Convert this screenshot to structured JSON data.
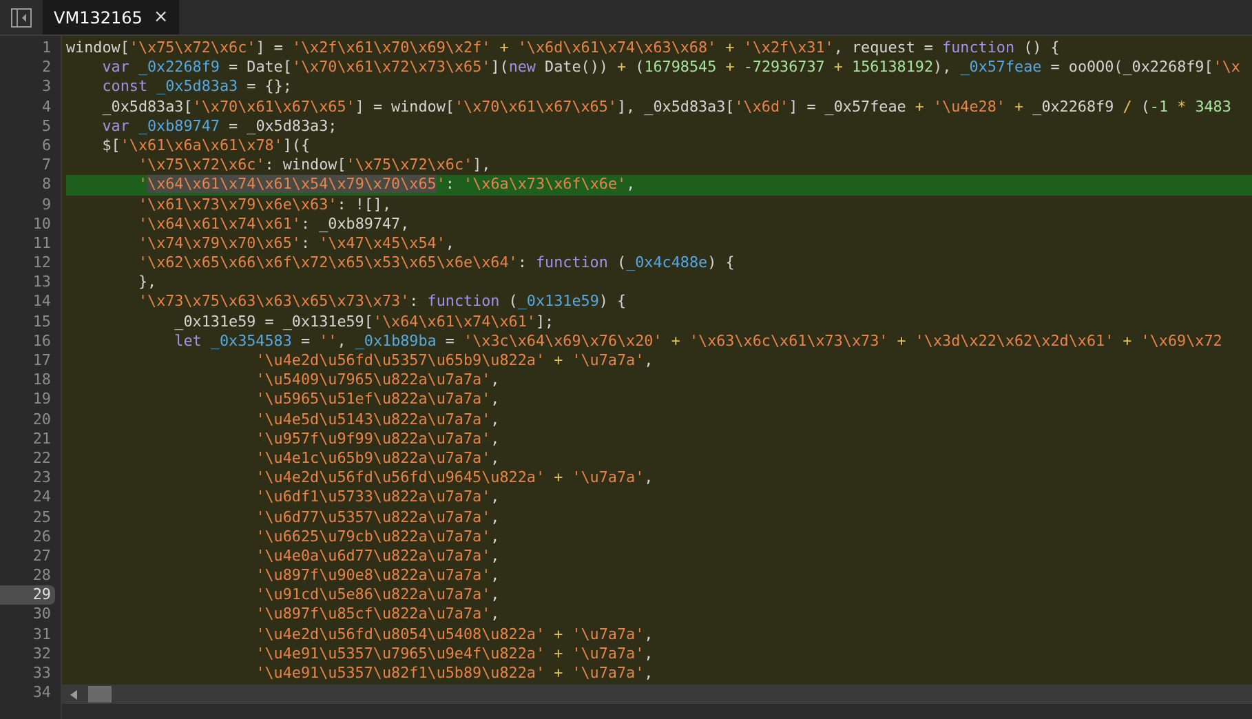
{
  "tab": {
    "title": "VM132165",
    "close": "×",
    "selected": true
  },
  "lines": [
    {
      "n": "1",
      "kind": "top",
      "highlighted": false,
      "marked": false,
      "tokens": [
        {
          "kind": "plain",
          "text": "window["
        },
        {
          "kind": "string",
          "text": "'\\x75\\x72\\x6c'"
        },
        {
          "kind": "plain",
          "text": "] = "
        },
        {
          "kind": "string",
          "text": "'\\x2f\\x61\\x70\\x69\\x2f'"
        },
        {
          "kind": "op",
          "text": " + "
        },
        {
          "kind": "string",
          "text": "'\\x6d\\x61\\x74\\x63\\x68'"
        },
        {
          "kind": "op",
          "text": " + "
        },
        {
          "kind": "string",
          "text": "'\\x2f\\x31'"
        },
        {
          "kind": "plain",
          "text": ", request = "
        },
        {
          "kind": "keyword",
          "text": "function"
        },
        {
          "kind": "plain",
          "text": " () {"
        }
      ]
    },
    {
      "n": "2",
      "kind": "body",
      "highlighted": false,
      "marked": false,
      "tokens": [
        {
          "kind": "keyword",
          "text": "var"
        },
        {
          "kind": "name",
          "text": " _0x2268f9"
        },
        {
          "kind": "plain",
          "text": " = Date["
        },
        {
          "kind": "string",
          "text": "'\\x70\\x61\\x72\\x73\\x65'"
        },
        {
          "kind": "plain",
          "text": "]("
        },
        {
          "kind": "keyword",
          "text": "new"
        },
        {
          "kind": "plain",
          "text": " Date())"
        },
        {
          "kind": "op",
          "text": " + "
        },
        {
          "kind": "plain",
          "text": "("
        },
        {
          "kind": "number",
          "text": "16798545"
        },
        {
          "kind": "op",
          "text": " + "
        },
        {
          "kind": "number",
          "text": "-72936737"
        },
        {
          "kind": "op",
          "text": " + "
        },
        {
          "kind": "number",
          "text": "156138192"
        },
        {
          "kind": "plain",
          "text": "), "
        },
        {
          "kind": "name",
          "text": "_0x57feae"
        },
        {
          "kind": "plain",
          "text": " = oo0O0(_0x2268f9["
        },
        {
          "kind": "string",
          "text": "'\\x"
        }
      ]
    },
    {
      "n": "3",
      "kind": "body",
      "highlighted": false,
      "marked": false,
      "tokens": [
        {
          "kind": "keyword",
          "text": "const"
        },
        {
          "kind": "name",
          "text": " _0x5d83a3"
        },
        {
          "kind": "plain",
          "text": " = {};"
        }
      ]
    },
    {
      "n": "4",
      "kind": "body",
      "highlighted": false,
      "marked": false,
      "tokens": [
        {
          "kind": "plain",
          "text": "_0x5d83a3["
        },
        {
          "kind": "string",
          "text": "'\\x70\\x61\\x67\\x65'"
        },
        {
          "kind": "plain",
          "text": "] = window["
        },
        {
          "kind": "string",
          "text": "'\\x70\\x61\\x67\\x65'"
        },
        {
          "kind": "plain",
          "text": "], _0x5d83a3["
        },
        {
          "kind": "string",
          "text": "'\\x6d'"
        },
        {
          "kind": "plain",
          "text": "] = _0x57feae"
        },
        {
          "kind": "op",
          "text": " + "
        },
        {
          "kind": "string",
          "text": "'\\u4e28'"
        },
        {
          "kind": "op",
          "text": " + "
        },
        {
          "kind": "plain",
          "text": "_0x2268f9"
        },
        {
          "kind": "op",
          "text": " / "
        },
        {
          "kind": "plain",
          "text": "("
        },
        {
          "kind": "number",
          "text": "-1"
        },
        {
          "kind": "op",
          "text": " * "
        },
        {
          "kind": "number",
          "text": "3483"
        }
      ]
    },
    {
      "n": "5",
      "kind": "body",
      "highlighted": false,
      "marked": false,
      "tokens": [
        {
          "kind": "keyword",
          "text": "var"
        },
        {
          "kind": "name",
          "text": " _0xb89747"
        },
        {
          "kind": "plain",
          "text": " = _0x5d83a3;"
        }
      ]
    },
    {
      "n": "6",
      "kind": "body",
      "highlighted": false,
      "marked": false,
      "tokens": [
        {
          "kind": "plain",
          "text": "$["
        },
        {
          "kind": "string",
          "text": "'\\x61\\x6a\\x61\\x78'"
        },
        {
          "kind": "plain",
          "text": "]({"
        }
      ]
    },
    {
      "n": "7",
      "kind": "option",
      "highlighted": false,
      "marked": false,
      "tokens": [
        {
          "kind": "string",
          "text": "'\\x75\\x72\\x6c'"
        },
        {
          "kind": "plain",
          "text": ": window["
        },
        {
          "kind": "string",
          "text": "'\\x75\\x72\\x6c'"
        },
        {
          "kind": "plain",
          "text": "],"
        }
      ]
    },
    {
      "n": "8",
      "kind": "option",
      "highlighted": true,
      "marked": false,
      "tokens": [
        {
          "kind": "string",
          "text": "'"
        },
        {
          "kind": "selection",
          "text": "\\x64\\x61\\x74\\x61\\x54\\x79\\x70\\x65"
        },
        {
          "kind": "string",
          "text": "'"
        },
        {
          "kind": "plain",
          "text": ": "
        },
        {
          "kind": "string",
          "text": "'\\x6a\\x73\\x6f\\x6e'"
        },
        {
          "kind": "plain",
          "text": ","
        }
      ]
    },
    {
      "n": "9",
      "kind": "option",
      "highlighted": false,
      "marked": false,
      "tokens": [
        {
          "kind": "string",
          "text": "'\\x61\\x73\\x79\\x6e\\x63'"
        },
        {
          "kind": "plain",
          "text": ": ![],"
        }
      ]
    },
    {
      "n": "10",
      "kind": "option",
      "highlighted": false,
      "marked": false,
      "tokens": [
        {
          "kind": "string",
          "text": "'\\x64\\x61\\x74\\x61'"
        },
        {
          "kind": "plain",
          "text": ": _0xb89747,"
        }
      ]
    },
    {
      "n": "11",
      "kind": "option",
      "highlighted": false,
      "marked": false,
      "tokens": [
        {
          "kind": "string",
          "text": "'\\x74\\x79\\x70\\x65'"
        },
        {
          "kind": "plain",
          "text": ": "
        },
        {
          "kind": "string",
          "text": "'\\x47\\x45\\x54'"
        },
        {
          "kind": "plain",
          "text": ","
        }
      ]
    },
    {
      "n": "12",
      "kind": "option",
      "highlighted": false,
      "marked": false,
      "tokens": [
        {
          "kind": "string",
          "text": "'\\x62\\x65\\x66\\x6f\\x72\\x65\\x53\\x65\\x6e\\x64'"
        },
        {
          "kind": "plain",
          "text": ": "
        },
        {
          "kind": "keyword",
          "text": "function"
        },
        {
          "kind": "plain",
          "text": " ("
        },
        {
          "kind": "name",
          "text": "_0x4c488e"
        },
        {
          "kind": "plain",
          "text": ") {"
        }
      ]
    },
    {
      "n": "13",
      "kind": "option",
      "highlighted": false,
      "marked": false,
      "tokens": [
        {
          "kind": "plain",
          "text": "},"
        }
      ]
    },
    {
      "n": "14",
      "kind": "option",
      "highlighted": false,
      "marked": false,
      "tokens": [
        {
          "kind": "string",
          "text": "'\\x73\\x75\\x63\\x63\\x65\\x73\\x73'"
        },
        {
          "kind": "plain",
          "text": ": "
        },
        {
          "kind": "keyword",
          "text": "function"
        },
        {
          "kind": "plain",
          "text": " ("
        },
        {
          "kind": "name",
          "text": "_0x131e59"
        },
        {
          "kind": "plain",
          "text": ") {"
        }
      ]
    },
    {
      "n": "15",
      "kind": "handler",
      "highlighted": false,
      "marked": false,
      "tokens": [
        {
          "kind": "plain",
          "text": "_0x131e59 = _0x131e59["
        },
        {
          "kind": "string",
          "text": "'\\x64\\x61\\x74\\x61'"
        },
        {
          "kind": "plain",
          "text": "];"
        }
      ]
    },
    {
      "n": "16",
      "kind": "handler",
      "highlighted": false,
      "marked": false,
      "tokens": [
        {
          "kind": "keyword",
          "text": "let"
        },
        {
          "kind": "name",
          "text": " _0x354583"
        },
        {
          "kind": "plain",
          "text": " = "
        },
        {
          "kind": "string",
          "text": "''"
        },
        {
          "kind": "plain",
          "text": ", "
        },
        {
          "kind": "name",
          "text": "_0x1b89ba"
        },
        {
          "kind": "plain",
          "text": " = "
        },
        {
          "kind": "string",
          "text": "'\\x3c\\x64\\x69\\x76\\x20'"
        },
        {
          "kind": "op",
          "text": " + "
        },
        {
          "kind": "string",
          "text": "'\\x63\\x6c\\x61\\x73\\x73'"
        },
        {
          "kind": "op",
          "text": " + "
        },
        {
          "kind": "string",
          "text": "'\\x3d\\x22\\x62\\x2d\\x61'"
        },
        {
          "kind": "op",
          "text": " + "
        },
        {
          "kind": "string",
          "text": "'\\x69\\x72"
        }
      ]
    },
    {
      "n": "17",
      "kind": "list",
      "highlighted": false,
      "marked": false,
      "tokens": [
        {
          "kind": "string",
          "text": "'\\u4e2d\\u56fd\\u5357\\u65b9\\u822a'"
        },
        {
          "kind": "op",
          "text": " + "
        },
        {
          "kind": "string",
          "text": "'\\u7a7a'"
        },
        {
          "kind": "plain",
          "text": ","
        }
      ]
    },
    {
      "n": "18",
      "kind": "list",
      "highlighted": false,
      "marked": false,
      "tokens": [
        {
          "kind": "string",
          "text": "'\\u5409\\u7965\\u822a\\u7a7a'"
        },
        {
          "kind": "plain",
          "text": ","
        }
      ]
    },
    {
      "n": "19",
      "kind": "list",
      "highlighted": false,
      "marked": false,
      "tokens": [
        {
          "kind": "string",
          "text": "'\\u5965\\u51ef\\u822a\\u7a7a'"
        },
        {
          "kind": "plain",
          "text": ","
        }
      ]
    },
    {
      "n": "20",
      "kind": "list",
      "highlighted": false,
      "marked": false,
      "tokens": [
        {
          "kind": "string",
          "text": "'\\u4e5d\\u5143\\u822a\\u7a7a'"
        },
        {
          "kind": "plain",
          "text": ","
        }
      ]
    },
    {
      "n": "21",
      "kind": "list",
      "highlighted": false,
      "marked": false,
      "tokens": [
        {
          "kind": "string",
          "text": "'\\u957f\\u9f99\\u822a\\u7a7a'"
        },
        {
          "kind": "plain",
          "text": ","
        }
      ]
    },
    {
      "n": "22",
      "kind": "list",
      "highlighted": false,
      "marked": false,
      "tokens": [
        {
          "kind": "string",
          "text": "'\\u4e1c\\u65b9\\u822a\\u7a7a'"
        },
        {
          "kind": "plain",
          "text": ","
        }
      ]
    },
    {
      "n": "23",
      "kind": "list",
      "highlighted": false,
      "marked": false,
      "tokens": [
        {
          "kind": "string",
          "text": "'\\u4e2d\\u56fd\\u56fd\\u9645\\u822a'"
        },
        {
          "kind": "op",
          "text": " + "
        },
        {
          "kind": "string",
          "text": "'\\u7a7a'"
        },
        {
          "kind": "plain",
          "text": ","
        }
      ]
    },
    {
      "n": "24",
      "kind": "list",
      "highlighted": false,
      "marked": false,
      "tokens": [
        {
          "kind": "string",
          "text": "'\\u6df1\\u5733\\u822a\\u7a7a'"
        },
        {
          "kind": "plain",
          "text": ","
        }
      ]
    },
    {
      "n": "25",
      "kind": "list",
      "highlighted": false,
      "marked": false,
      "tokens": [
        {
          "kind": "string",
          "text": "'\\u6d77\\u5357\\u822a\\u7a7a'"
        },
        {
          "kind": "plain",
          "text": ","
        }
      ]
    },
    {
      "n": "26",
      "kind": "list",
      "highlighted": false,
      "marked": false,
      "tokens": [
        {
          "kind": "string",
          "text": "'\\u6625\\u79cb\\u822a\\u7a7a'"
        },
        {
          "kind": "plain",
          "text": ","
        }
      ]
    },
    {
      "n": "27",
      "kind": "list",
      "highlighted": false,
      "marked": false,
      "tokens": [
        {
          "kind": "string",
          "text": "'\\u4e0a\\u6d77\\u822a\\u7a7a'"
        },
        {
          "kind": "plain",
          "text": ","
        }
      ]
    },
    {
      "n": "28",
      "kind": "list",
      "highlighted": false,
      "marked": false,
      "tokens": [
        {
          "kind": "string",
          "text": "'\\u897f\\u90e8\\u822a\\u7a7a'"
        },
        {
          "kind": "plain",
          "text": ","
        }
      ]
    },
    {
      "n": "29",
      "kind": "list",
      "highlighted": false,
      "marked": true,
      "tokens": [
        {
          "kind": "string",
          "text": "'\\u91cd\\u5e86\\u822a\\u7a7a'"
        },
        {
          "kind": "plain",
          "text": ","
        }
      ]
    },
    {
      "n": "30",
      "kind": "list",
      "highlighted": false,
      "marked": false,
      "tokens": [
        {
          "kind": "string",
          "text": "'\\u897f\\u85cf\\u822a\\u7a7a'"
        },
        {
          "kind": "plain",
          "text": ","
        }
      ]
    },
    {
      "n": "31",
      "kind": "list",
      "highlighted": false,
      "marked": false,
      "tokens": [
        {
          "kind": "string",
          "text": "'\\u4e2d\\u56fd\\u8054\\u5408\\u822a'"
        },
        {
          "kind": "op",
          "text": " + "
        },
        {
          "kind": "string",
          "text": "'\\u7a7a'"
        },
        {
          "kind": "plain",
          "text": ","
        }
      ]
    },
    {
      "n": "32",
      "kind": "list",
      "highlighted": false,
      "marked": false,
      "tokens": [
        {
          "kind": "string",
          "text": "'\\u4e91\\u5357\\u7965\\u9e4f\\u822a'"
        },
        {
          "kind": "op",
          "text": " + "
        },
        {
          "kind": "string",
          "text": "'\\u7a7a'"
        },
        {
          "kind": "plain",
          "text": ","
        }
      ]
    },
    {
      "n": "33",
      "kind": "list",
      "highlighted": false,
      "marked": false,
      "tokens": [
        {
          "kind": "string",
          "text": "'\\u4e91\\u5357\\u82f1\\u5b89\\u822a'"
        },
        {
          "kind": "op",
          "text": " + "
        },
        {
          "kind": "string",
          "text": "'\\u7a7a'"
        },
        {
          "kind": "plain",
          "text": ","
        }
      ]
    }
  ],
  "last_line_number": "34"
}
